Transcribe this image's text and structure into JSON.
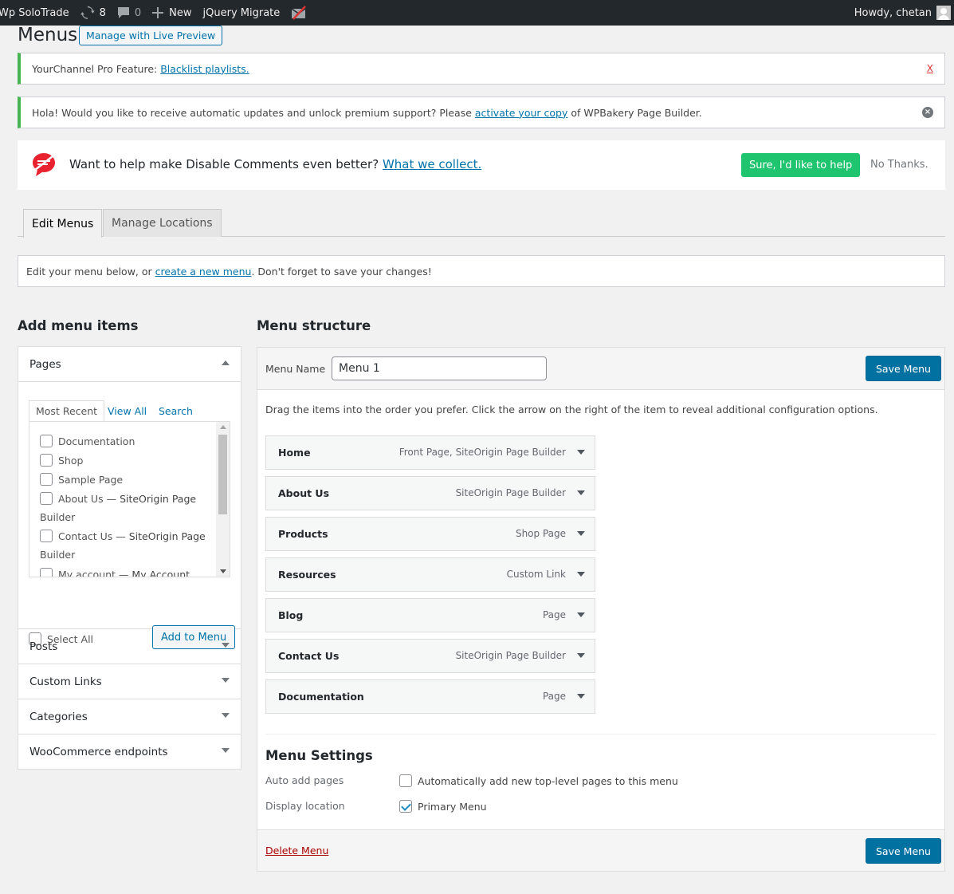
{
  "adminbar": {
    "site_name": "Wp SoloTrade",
    "updates_count": "8",
    "comments_count": "0",
    "new_label": "New",
    "plugin_label": "jQuery Migrate",
    "greeting": "Howdy, chetan"
  },
  "page": {
    "title": "Menus",
    "live_preview_label": "Manage with Live Preview"
  },
  "notices": {
    "yourchannel_prefix": "YourChannel Pro Feature:",
    "yourchannel_link": "Blacklist playlists.",
    "yourchannel_close": "X",
    "wpbakery_prefix": "Hola! Would you like to receive automatic updates and unlock premium support? Please",
    "wpbakery_link": "activate your copy",
    "wpbakery_suffix": "of WPBakery Page Builder.",
    "dc_text": "Want to help make Disable Comments even better?",
    "dc_link": "What we collect.",
    "dc_yes": "Sure, I'd like to help",
    "dc_no": "No Thanks."
  },
  "tabs": {
    "edit_menus": "Edit Menus",
    "manage_locations": "Manage Locations"
  },
  "info": {
    "prefix": "Edit your menu below, or",
    "link": "create a new menu",
    "suffix": ". Don't forget to save your changes!"
  },
  "add_items": {
    "heading": "Add menu items",
    "pages": {
      "title": "Pages",
      "tab_recent": "Most Recent",
      "tab_all": "View All",
      "tab_search": "Search",
      "items": [
        {
          "name": "Documentation",
          "suffix": ""
        },
        {
          "name": "Shop",
          "suffix": ""
        },
        {
          "name": "Sample Page",
          "suffix": ""
        },
        {
          "name": "About Us —",
          "suffix": "SiteOrigin Page",
          "cont": "Builder"
        },
        {
          "name": "Contact Us —",
          "suffix": "SiteOrigin Page",
          "cont": "Builder"
        },
        {
          "name": "My account —",
          "suffix": "My Account"
        }
      ],
      "select_all": "Select All",
      "add_button": "Add to Menu"
    },
    "sections": [
      "Posts",
      "Custom Links",
      "Categories",
      "WooCommerce endpoints"
    ]
  },
  "structure": {
    "heading": "Menu structure",
    "menu_name_label": "Menu Name",
    "menu_name_value": "Menu 1",
    "save_label": "Save Menu",
    "instructions": "Drag the items into the order you prefer. Click the arrow on the right of the item to reveal additional configuration options.",
    "items": [
      {
        "title": "Home",
        "type": "Front Page, SiteOrigin Page Builder"
      },
      {
        "title": "About Us",
        "type": "SiteOrigin Page Builder"
      },
      {
        "title": "Products",
        "type": "Shop Page"
      },
      {
        "title": "Resources",
        "type": "Custom Link"
      },
      {
        "title": "Blog",
        "type": "Page"
      },
      {
        "title": "Contact Us",
        "type": "SiteOrigin Page Builder"
      },
      {
        "title": "Documentation",
        "type": "Page"
      }
    ],
    "settings": {
      "heading": "Menu Settings",
      "auto_add_label": "Auto add pages",
      "auto_add_option": "Automatically add new top-level pages to this menu",
      "auto_add_checked": false,
      "display_label": "Display location",
      "display_option": "Primary Menu",
      "display_checked": true
    },
    "delete_label": "Delete Menu"
  },
  "colors": {
    "adminbar_bg": "#23282d",
    "primary_blue": "#0071a1",
    "link_blue": "#0073aa",
    "notice_green": "#46b450",
    "help_green": "#1ec46e",
    "delete_red": "#aa0000"
  }
}
